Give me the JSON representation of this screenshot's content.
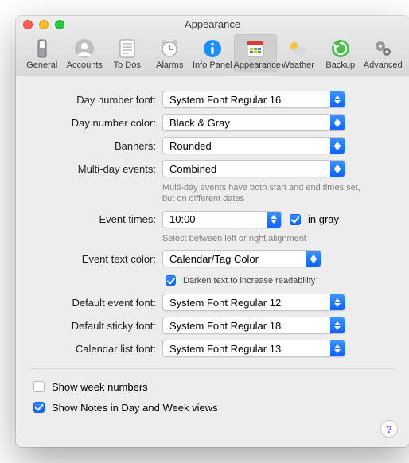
{
  "window": {
    "title": "Appearance"
  },
  "toolbar": {
    "items": [
      {
        "label": "General",
        "icon": "switch-icon"
      },
      {
        "label": "Accounts",
        "icon": "user-icon"
      },
      {
        "label": "To Dos",
        "icon": "list-icon"
      },
      {
        "label": "Alarms",
        "icon": "alarm-icon"
      },
      {
        "label": "Info Panel",
        "icon": "info-icon"
      },
      {
        "label": "Appearance",
        "icon": "calendar-icon"
      },
      {
        "label": "Weather",
        "icon": "weather-icon"
      },
      {
        "label": "Backup",
        "icon": "backup-icon"
      },
      {
        "label": "Advanced",
        "icon": "gears-icon"
      }
    ],
    "selected_index": 5
  },
  "form": {
    "day_number_font": {
      "label": "Day number font:",
      "value": "System Font Regular 16"
    },
    "day_number_color": {
      "label": "Day number color:",
      "value": "Black & Gray"
    },
    "banners": {
      "label": "Banners:",
      "value": "Rounded"
    },
    "multi_day_events": {
      "label": "Multi-day events:",
      "value": "Combined",
      "hint": "Multi-day events have both start and end times set, but on different dates"
    },
    "event_times": {
      "label": "Event times:",
      "value": "10:00",
      "in_gray_label": "in gray",
      "in_gray_checked": true,
      "hint": "Select between left or right alignment"
    },
    "event_text_color": {
      "label": "Event text color:",
      "value": "Calendar/Tag Color",
      "darken_label": "Darken text to increase readability",
      "darken_checked": true
    },
    "default_event_font": {
      "label": "Default event font:",
      "value": "System Font Regular 12"
    },
    "default_sticky_font": {
      "label": "Default sticky font:",
      "value": "System Font Regular 18"
    },
    "calendar_list_font": {
      "label": "Calendar list font:",
      "value": "System Font Regular 13"
    }
  },
  "bottom": {
    "show_week_numbers": {
      "label": "Show week numbers",
      "checked": false
    },
    "show_notes": {
      "label": "Show Notes in Day and Week views",
      "checked": true
    }
  },
  "help": {
    "glyph": "?"
  }
}
